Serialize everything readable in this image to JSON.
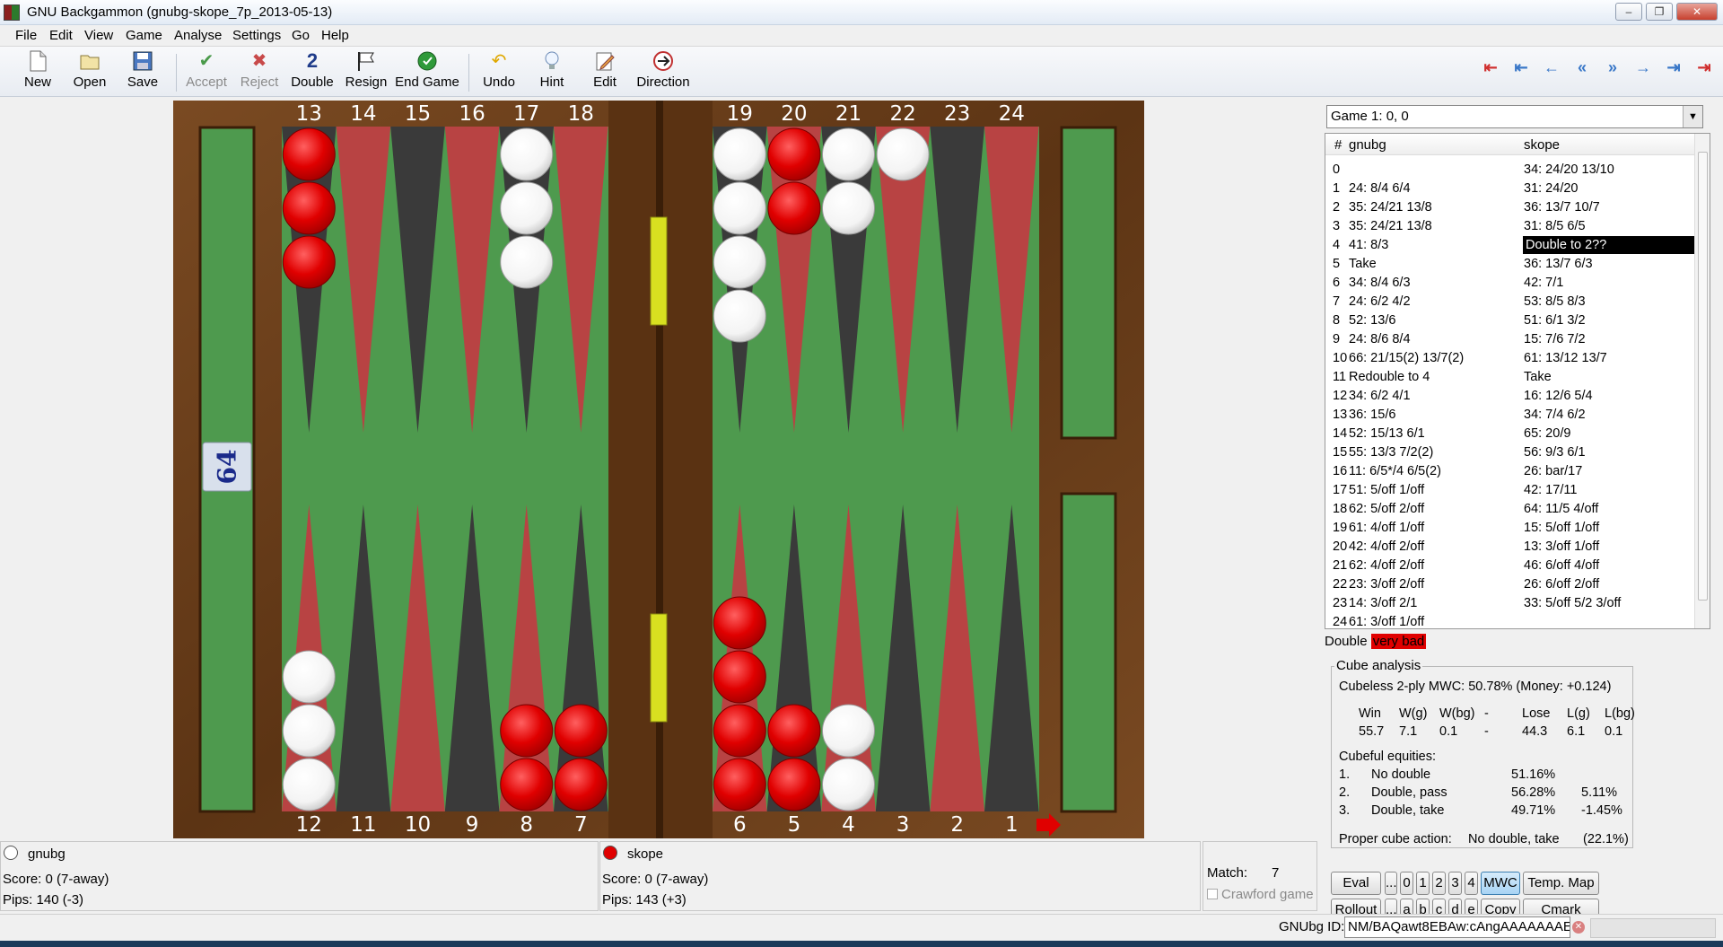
{
  "window": {
    "title": "GNU Backgammon (gnubg-skope_7p_2013-05-13)",
    "controls": [
      "–",
      "❐",
      "✕"
    ]
  },
  "menu": [
    "File",
    "Edit",
    "View",
    "Game",
    "Analyse",
    "Settings",
    "Go",
    "Help"
  ],
  "toolbar": {
    "new": "New",
    "open": "Open",
    "save": "Save",
    "accept": "Accept",
    "reject": "Reject",
    "double": "Double",
    "resign": "Resign",
    "end_game": "End Game",
    "undo": "Undo",
    "hint": "Hint",
    "edit": "Edit",
    "direction": "Direction",
    "double_icon_text": "2"
  },
  "nav_buttons": [
    "⇤",
    "⇤",
    "←",
    "«",
    "»",
    "→",
    "⇥",
    "⇥"
  ],
  "board": {
    "top_numbers": [
      "13",
      "14",
      "15",
      "16",
      "17",
      "18",
      "19",
      "20",
      "21",
      "22",
      "23",
      "24"
    ],
    "bottom_numbers": [
      "12",
      "11",
      "10",
      "9",
      "8",
      "7",
      "6",
      "5",
      "4",
      "3",
      "2",
      "1"
    ],
    "cube_value": "64",
    "colors": {
      "wood": "#6b3f1a",
      "felt": "#4e9a4e",
      "red_point": "#b84343",
      "dark_point": "#3a3a3a",
      "red_checker": "#e00000",
      "white_checker": "#ffffff",
      "hinge": "#d8e020"
    },
    "checkers": [
      {
        "point": 13,
        "color": "red",
        "count": 3
      },
      {
        "point": 17,
        "color": "white",
        "count": 3
      },
      {
        "point": 19,
        "color": "white",
        "count": 4
      },
      {
        "point": 20,
        "color": "red",
        "count": 2
      },
      {
        "point": 21,
        "color": "white",
        "count": 2
      },
      {
        "point": 22,
        "color": "white",
        "count": 1
      },
      {
        "point": 12,
        "color": "white",
        "count": 3
      },
      {
        "point": 8,
        "color": "red",
        "count": 2
      },
      {
        "point": 7,
        "color": "red",
        "count": 2
      },
      {
        "point": 6,
        "color": "red",
        "count": 4
      },
      {
        "point": 5,
        "color": "red",
        "count": 2
      },
      {
        "point": 4,
        "color": "white",
        "count": 2
      }
    ]
  },
  "game_select": {
    "value": "Game 1: 0, 0"
  },
  "moves": {
    "headers": {
      "num": "#",
      "p1": "gnubg",
      "p2": "skope"
    },
    "rows": [
      {
        "n": "0",
        "a": "",
        "b": "34: 24/20 13/10"
      },
      {
        "n": "1",
        "a": "24: 8/4 6/4",
        "b": "31: 24/20"
      },
      {
        "n": "2",
        "a": "35: 24/21 13/8",
        "b": "36: 13/7 10/7"
      },
      {
        "n": "3",
        "a": "35: 24/21 13/8",
        "b": "31: 8/5 6/5"
      },
      {
        "n": "4",
        "a": "41: 8/3",
        "b": "Double to 2??"
      },
      {
        "n": "5",
        "a": "Take",
        "b": "36: 13/7 6/3"
      },
      {
        "n": "6",
        "a": "34: 8/4 6/3",
        "b": "42: 7/1"
      },
      {
        "n": "7",
        "a": "24: 6/2 4/2",
        "b": "53: 8/5 8/3"
      },
      {
        "n": "8",
        "a": "52: 13/6",
        "b": "51: 6/1 3/2"
      },
      {
        "n": "9",
        "a": "24: 8/6 8/4",
        "b": "15: 7/6 7/2"
      },
      {
        "n": "10",
        "a": "66: 21/15(2) 13/7(2)",
        "b": "61: 13/12 13/7"
      },
      {
        "n": "11",
        "a": "Redouble to 4",
        "b": "Take"
      },
      {
        "n": "12",
        "a": "34: 6/2 4/1",
        "b": "16: 12/6 5/4"
      },
      {
        "n": "13",
        "a": "36: 15/6",
        "b": "34: 7/4 6/2"
      },
      {
        "n": "14",
        "a": "52: 15/13 6/1",
        "b": "65: 20/9"
      },
      {
        "n": "15",
        "a": "55: 13/3 7/2(2)",
        "b": "56: 9/3 6/1"
      },
      {
        "n": "16",
        "a": "11: 6/5*/4 6/5(2)",
        "b": "26: bar/17"
      },
      {
        "n": "17",
        "a": "51: 5/off 1/off",
        "b": "42: 17/11"
      },
      {
        "n": "18",
        "a": "62: 5/off 2/off",
        "b": "64: 11/5 4/off"
      },
      {
        "n": "19",
        "a": "61: 4/off 1/off",
        "b": "15: 5/off 1/off"
      },
      {
        "n": "20",
        "a": "42: 4/off 2/off",
        "b": "13: 3/off 1/off"
      },
      {
        "n": "21",
        "a": "62: 4/off 2/off",
        "b": "46: 6/off 4/off"
      },
      {
        "n": "22",
        "a": "23: 3/off 2/off",
        "b": "26: 6/off 2/off"
      },
      {
        "n": "23",
        "a": "14: 3/off 2/1",
        "b": "33: 5/off 5/2 3/off"
      },
      {
        "n": "24",
        "a": "61: 3/off 1/off",
        "b": ""
      }
    ],
    "selected_row": 4
  },
  "comment": {
    "prefix": "Double",
    "rating": "very bad"
  },
  "cube_analysis": {
    "legend": "Cube analysis",
    "cubeless": "Cubeless 2-ply MWC:  50.78% (Money: +0.124)",
    "headers": [
      "Win",
      "W(g)",
      "W(bg)",
      "-",
      "Lose",
      "L(g)",
      "L(bg)"
    ],
    "values": [
      "55.7",
      "7.1",
      "0.1",
      "-",
      "44.3",
      "6.1",
      "0.1"
    ],
    "cubeful_title": "Cubeful equities:",
    "options": [
      {
        "n": "1.",
        "label": "No double",
        "eq": "51.16%",
        "diff": ""
      },
      {
        "n": "2.",
        "label": "Double, pass",
        "eq": "56.28%",
        "diff": "5.11%"
      },
      {
        "n": "3.",
        "label": "Double, take",
        "eq": "49.71%",
        "diff": "-1.45%"
      }
    ],
    "proper_label": "Proper cube action:",
    "proper_value": "No double, take",
    "proper_pct": "(22.1%)"
  },
  "eval_buttons": {
    "row1": [
      "Eval",
      "...",
      "0",
      "1",
      "2",
      "3",
      "4",
      "MWC",
      "Temp. Map"
    ],
    "row2": [
      "Rollout",
      "...",
      "a",
      "b",
      "c",
      "d",
      "e",
      "Copy",
      "Cmark"
    ]
  },
  "players": {
    "p1": {
      "name": "gnubg",
      "score": "Score:  0 (7-away)",
      "pips": "Pips: 140 (-3)"
    },
    "p2": {
      "name": "skope",
      "score": "Score:  0 (7-away)",
      "pips": "Pips: 143 (+3)"
    }
  },
  "match": {
    "label": "Match:",
    "value": "7",
    "crawford": "Crawford game"
  },
  "status": {
    "id_label": "GNUbg ID:",
    "id_value": "NM/BAQawt8EBAw:cAngAAAAAAAE"
  }
}
